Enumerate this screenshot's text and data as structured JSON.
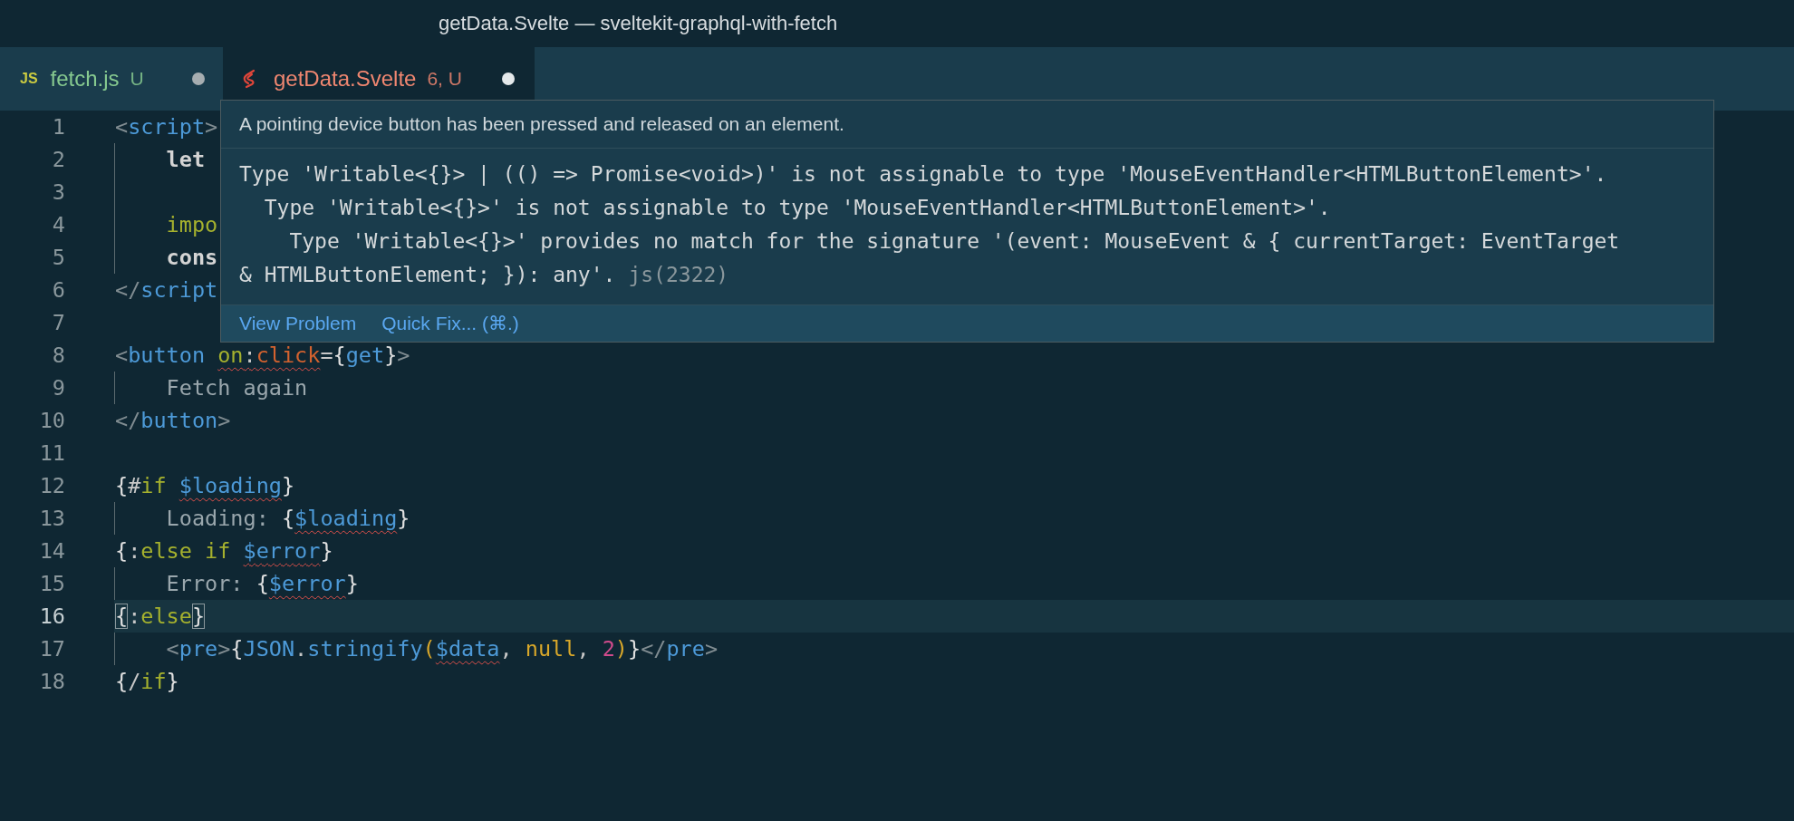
{
  "window": {
    "title": "getData.Svelte — sveltekit-graphql-with-fetch"
  },
  "tabs": [
    {
      "label": "fetch.js",
      "status": "U",
      "selected": false,
      "dirty": true,
      "color": "#86c98f",
      "icon": {
        "kind": "js",
        "text": "JS"
      }
    },
    {
      "label": "getData.Svelte",
      "status": "6, U",
      "selected": true,
      "dirty": true,
      "color": "#ef8670",
      "icon": {
        "kind": "svelte"
      }
    }
  ],
  "editor": {
    "lines": [
      {
        "number": "1",
        "current": false,
        "guide": false,
        "tokens": [
          {
            "text": "<",
            "kind": "punct",
            "squiggle": false
          },
          {
            "text": "script",
            "kind": "tag",
            "squiggle": false
          },
          {
            "text": ">",
            "kind": "punct",
            "squiggle": false
          }
        ]
      },
      {
        "number": "2",
        "current": false,
        "guide": true,
        "tokens": [
          {
            "text": "    let",
            "kind": "keyword",
            "squiggle": false
          }
        ]
      },
      {
        "number": "3",
        "current": false,
        "guide": true
      },
      {
        "number": "4",
        "current": false,
        "guide": true,
        "tokens": [
          {
            "text": "    impo",
            "kind": "import",
            "squiggle": false
          }
        ]
      },
      {
        "number": "5",
        "current": false,
        "guide": true,
        "tokens": [
          {
            "text": "    cons",
            "kind": "keyword",
            "squiggle": false
          }
        ]
      },
      {
        "number": "6",
        "current": false,
        "guide": false,
        "tokens": [
          {
            "text": "</",
            "kind": "punct",
            "squiggle": false
          },
          {
            "text": "script",
            "kind": "tag",
            "squiggle": false
          }
        ]
      },
      {
        "number": "7",
        "current": false,
        "guide": false
      },
      {
        "number": "8",
        "current": false,
        "guide": false,
        "tokens": [
          {
            "text": "<",
            "kind": "punct",
            "squiggle": false
          },
          {
            "text": "button ",
            "kind": "tag",
            "squiggle": false
          },
          {
            "text": "on",
            "kind": "control",
            "squiggle": true
          },
          {
            "text": ":",
            "kind": "plain",
            "squiggle": true
          },
          {
            "text": "click",
            "kind": "attribute",
            "squiggle": true
          },
          {
            "text": "=",
            "kind": "plain",
            "squiggle": false
          },
          {
            "text": "{",
            "kind": "brace",
            "squiggle": false
          },
          {
            "text": "get",
            "kind": "variable",
            "squiggle": false
          },
          {
            "text": "}",
            "kind": "brace",
            "squiggle": false
          },
          {
            "text": ">",
            "kind": "punct",
            "squiggle": false
          }
        ]
      },
      {
        "number": "9",
        "current": false,
        "guide": true,
        "tokens": [
          {
            "text": "    Fetch again",
            "kind": "text",
            "squiggle": false
          }
        ]
      },
      {
        "number": "10",
        "current": false,
        "guide": false,
        "tokens": [
          {
            "text": "</",
            "kind": "punct",
            "squiggle": false
          },
          {
            "text": "button",
            "kind": "tag",
            "squiggle": false
          },
          {
            "text": ">",
            "kind": "punct",
            "squiggle": false
          }
        ]
      },
      {
        "number": "11",
        "current": false,
        "guide": false
      },
      {
        "number": "12",
        "current": false,
        "guide": false,
        "tokens": [
          {
            "text": "{",
            "kind": "brace",
            "squiggle": false
          },
          {
            "text": "#",
            "kind": "plain",
            "squiggle": false
          },
          {
            "text": "if ",
            "kind": "control",
            "squiggle": false
          },
          {
            "text": "$loading",
            "kind": "variable",
            "squiggle": true
          },
          {
            "text": "}",
            "kind": "brace",
            "squiggle": false
          }
        ]
      },
      {
        "number": "13",
        "current": false,
        "guide": true,
        "tokens": [
          {
            "text": "    Loading: ",
            "kind": "text",
            "squiggle": false
          },
          {
            "text": "{",
            "kind": "brace",
            "squiggle": false
          },
          {
            "text": "$loading",
            "kind": "variable",
            "squiggle": true
          },
          {
            "text": "}",
            "kind": "brace",
            "squiggle": false
          }
        ]
      },
      {
        "number": "14",
        "current": false,
        "guide": false,
        "tokens": [
          {
            "text": "{",
            "kind": "brace",
            "squiggle": false
          },
          {
            "text": ":",
            "kind": "plain",
            "squiggle": false
          },
          {
            "text": "else if ",
            "kind": "control",
            "squiggle": false
          },
          {
            "text": "$error",
            "kind": "variable",
            "squiggle": true
          },
          {
            "text": "}",
            "kind": "brace",
            "squiggle": false
          }
        ]
      },
      {
        "number": "15",
        "current": false,
        "guide": true,
        "tokens": [
          {
            "text": "    Error: ",
            "kind": "text",
            "squiggle": false
          },
          {
            "text": "{",
            "kind": "brace",
            "squiggle": false
          },
          {
            "text": "$error",
            "kind": "variable",
            "squiggle": true
          },
          {
            "text": "}",
            "kind": "brace",
            "squiggle": false
          }
        ]
      },
      {
        "number": "16",
        "current": true,
        "guide": false,
        "tokens": [
          {
            "text": "{",
            "kind": "matched-brace",
            "squiggle": false
          },
          {
            "text": ":",
            "kind": "plain",
            "squiggle": false
          },
          {
            "text": "else",
            "kind": "control",
            "squiggle": false
          },
          {
            "text": "}",
            "kind": "matched-brace",
            "squiggle": false
          }
        ]
      },
      {
        "number": "17",
        "current": false,
        "guide": true,
        "tokens": [
          {
            "text": "    <",
            "kind": "punct",
            "squiggle": false
          },
          {
            "text": "pre",
            "kind": "tag",
            "squiggle": false
          },
          {
            "text": ">",
            "kind": "punct",
            "squiggle": false
          },
          {
            "text": "{",
            "kind": "brace",
            "squiggle": false
          },
          {
            "text": "JSON",
            "kind": "variable",
            "squiggle": false
          },
          {
            "text": ".",
            "kind": "plain",
            "squiggle": false
          },
          {
            "text": "stringify",
            "kind": "variable",
            "squiggle": false
          },
          {
            "text": "(",
            "kind": "paren",
            "squiggle": false
          },
          {
            "text": "$data",
            "kind": "variable",
            "squiggle": true
          },
          {
            "text": ", ",
            "kind": "plain",
            "squiggle": false
          },
          {
            "text": "null",
            "kind": "literal",
            "squiggle": false
          },
          {
            "text": ", ",
            "kind": "plain",
            "squiggle": false
          },
          {
            "text": "2",
            "kind": "number",
            "squiggle": false
          },
          {
            "text": ")",
            "kind": "paren",
            "squiggle": false
          },
          {
            "text": "}",
            "kind": "brace",
            "squiggle": false
          },
          {
            "text": "</",
            "kind": "punct",
            "squiggle": false
          },
          {
            "text": "pre",
            "kind": "tag",
            "squiggle": false
          },
          {
            "text": ">",
            "kind": "punct",
            "squiggle": false
          }
        ]
      },
      {
        "number": "18",
        "current": false,
        "guide": false,
        "tokens": [
          {
            "text": "{",
            "kind": "brace",
            "squiggle": false
          },
          {
            "text": "/",
            "kind": "plain",
            "squiggle": false
          },
          {
            "text": "if",
            "kind": "control",
            "squiggle": false
          },
          {
            "text": "}",
            "kind": "brace",
            "squiggle": false
          }
        ]
      }
    ]
  },
  "hover": {
    "description": "A pointing device button has been pressed and released on an element.",
    "message_lines": [
      "Type 'Writable<{}> | (() => Promise<void>)' is not assignable to type 'MouseEventHandler<HTMLButtonElement>'.",
      "  Type 'Writable<{}>' is not assignable to type 'MouseEventHandler<HTMLButtonElement>'.",
      "    Type 'Writable<{}>' provides no match for the signature '(event: MouseEvent & { currentTarget: EventTarget",
      "& HTMLButtonElement; }): any'."
    ],
    "source": "js(2322)",
    "actions": [
      "View Problem",
      "Quick Fix... (⌘.)"
    ]
  }
}
